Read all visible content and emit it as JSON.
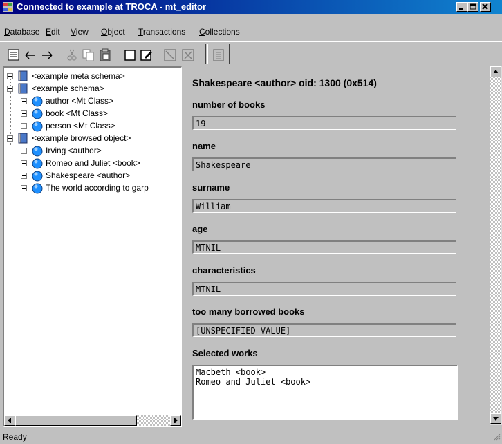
{
  "window": {
    "title": "Connected to example at TROCA - mt_editor",
    "icon": "app-icon"
  },
  "menu": {
    "items": [
      {
        "label": "Database",
        "underline": "D"
      },
      {
        "label": "Edit",
        "underline": "E"
      },
      {
        "label": "View",
        "underline": "V"
      },
      {
        "label": "Object",
        "underline": "O"
      },
      {
        "label": "Transactions",
        "underline": "T"
      },
      {
        "label": "Collections",
        "underline": "C"
      }
    ]
  },
  "toolbar": {
    "icons": [
      "list-icon",
      "back-arrow-icon",
      "forward-arrow-icon",
      "cut-icon",
      "copy-icon",
      "paste-icon",
      "new-object-icon",
      "edit-object-icon",
      "delete-icon",
      "delete-all-icon",
      "properties-icon"
    ]
  },
  "tree": {
    "items": [
      {
        "label": "<example meta schema>",
        "icon": "schema-book-icon",
        "level": 0,
        "expander": "+"
      },
      {
        "label": "<example schema>",
        "icon": "schema-book-icon",
        "level": 0,
        "expander": "-"
      },
      {
        "label": "author <Mt Class>",
        "icon": "object-sphere-icon",
        "level": 1,
        "expander": "+"
      },
      {
        "label": "book <Mt Class>",
        "icon": "object-sphere-icon",
        "level": 1,
        "expander": "+"
      },
      {
        "label": "person <Mt Class>",
        "icon": "object-sphere-icon",
        "level": 1,
        "expander": "+"
      },
      {
        "label": "<example browsed object>",
        "icon": "schema-book-icon",
        "level": 0,
        "expander": "-"
      },
      {
        "label": "Irving <author>",
        "icon": "object-sphere-icon",
        "level": 1,
        "expander": "+"
      },
      {
        "label": "Romeo and Juliet <book>",
        "icon": "object-sphere-icon",
        "level": 1,
        "expander": "+"
      },
      {
        "label": "Shakespeare <author>",
        "icon": "object-sphere-icon",
        "level": 1,
        "expander": "+"
      },
      {
        "label": "The world according to garp",
        "icon": "object-sphere-icon",
        "level": 1,
        "expander": "+"
      }
    ]
  },
  "detail": {
    "header": "Shakespeare <author> oid: 1300 (0x514)",
    "fields": [
      {
        "label": "number of books",
        "value": "19"
      },
      {
        "label": "name",
        "value": "Shakespeare"
      },
      {
        "label": "surname",
        "value": "William"
      },
      {
        "label": "age",
        "value": "MTNIL"
      },
      {
        "label": "characteristics",
        "value": "MTNIL"
      },
      {
        "label": "too many borrowed books",
        "value": "[UNSPECIFIED VALUE]"
      }
    ],
    "works_label": "Selected works",
    "works": [
      "Macbeth <book>",
      "Romeo and Juliet <book>"
    ]
  },
  "status": {
    "text": "Ready"
  },
  "colors": {
    "titlebar_start": "#000080",
    "titlebar_end": "#1084d0",
    "face": "#c0c0c0",
    "sphere": "#1e90ff",
    "book": "#4a78c8"
  }
}
